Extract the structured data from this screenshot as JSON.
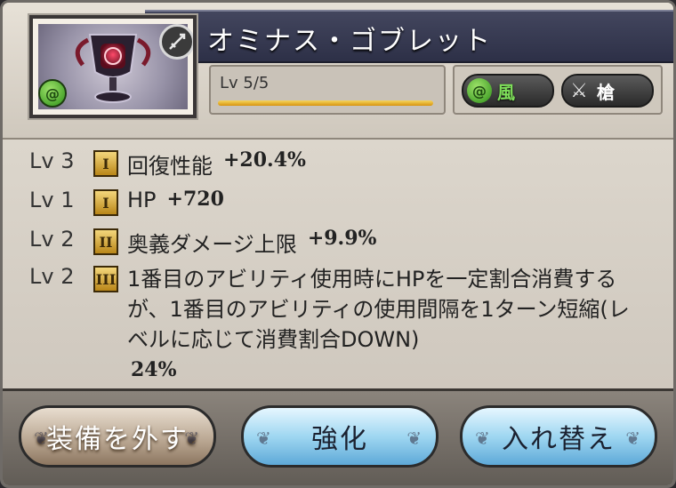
{
  "weapon": {
    "name": "オミナス・ゴブレット",
    "level_text": "Lv 5/5",
    "level_progress": 1.0
  },
  "tags": {
    "element_label": "風",
    "type_label": "槍"
  },
  "icons": {
    "element_icon": "wind-element-icon",
    "type_icon": "spear-icon"
  },
  "colors": {
    "title_bar": "#2d3047",
    "wind": "#7fe05a",
    "upgrade_button": "#9fd7f1"
  },
  "skills": [
    {
      "lv": "Lv 3",
      "rank": "I",
      "name": "回復性能",
      "value": "+20.4%"
    },
    {
      "lv": "Lv 1",
      "rank": "I",
      "name": "HP",
      "value": "+720"
    },
    {
      "lv": "Lv 2",
      "rank": "II",
      "name": "奥義ダメージ上限",
      "value": "+9.9%"
    },
    {
      "lv": "Lv 2",
      "rank": "III",
      "desc": "1番目のアビリティ使用時にHPを一定割合消費するが、1番目のアビリティの使用間隔を1ターン短縮(レベルに応じて消費割合DOWN)",
      "value": "24%"
    }
  ],
  "buttons": {
    "unequip": "装備を外す",
    "upgrade": "強化",
    "swap": "入れ替え"
  }
}
